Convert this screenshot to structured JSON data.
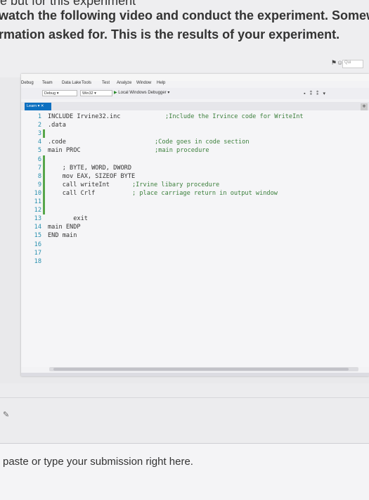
{
  "page": {
    "cut_text": "e but for this experiment",
    "instruction_line1": "watch the following video and conduct the experiment. Somewh",
    "instruction_line2": "rmation asked for. This is the results of your experiment.",
    "submission_placeholder": "paste or type your submission right here."
  },
  "vs": {
    "quick_launch": "Qui",
    "menu": [
      "Debug",
      "Team",
      "Data Lake",
      "Tools",
      "Test",
      "Analyze",
      "Window",
      "Help"
    ],
    "toolbar": {
      "config": "Debug",
      "platform": "Win32",
      "run_label": "Local Windows Debugger"
    },
    "tab": "Learn",
    "code_lines": [
      {
        "n": "1",
        "code": "INCLUDE Irvine32.inc",
        "comment": ";Include the Irvince code for WriteInt"
      },
      {
        "n": "2",
        "code": ".data",
        "comment": ""
      },
      {
        "n": "3",
        "code": "",
        "comment": ""
      },
      {
        "n": "4",
        "code": ".code",
        "comment": ";Code goes in code section"
      },
      {
        "n": "5",
        "code": "main PROC",
        "comment": ";main procedure"
      },
      {
        "n": "6",
        "code": "",
        "comment": ""
      },
      {
        "n": "7",
        "code": "    ; BYTE, WORD, DWORD",
        "comment": ""
      },
      {
        "n": "8",
        "code": "    mov EAX, SIZEOF BYTE",
        "comment": ""
      },
      {
        "n": "9",
        "code": "    call writeInt",
        "comment": ";Irvine libary procedure"
      },
      {
        "n": "10",
        "code": "    call Crlf",
        "comment": "; place carriage return in output window"
      },
      {
        "n": "11",
        "code": "",
        "comment": ""
      },
      {
        "n": "12",
        "code": "",
        "comment": ""
      },
      {
        "n": "13",
        "code": "       exit",
        "comment": ""
      },
      {
        "n": "14",
        "code": "main ENDP",
        "comment": ""
      },
      {
        "n": "15",
        "code": "END main",
        "comment": ""
      },
      {
        "n": "16",
        "code": "",
        "comment": ""
      },
      {
        "n": "17",
        "code": "",
        "comment": ""
      },
      {
        "n": "18",
        "code": "",
        "comment": ""
      }
    ],
    "changed_lines": [
      "3",
      "6",
      "7",
      "8",
      "9",
      "10",
      "11",
      "12"
    ]
  }
}
